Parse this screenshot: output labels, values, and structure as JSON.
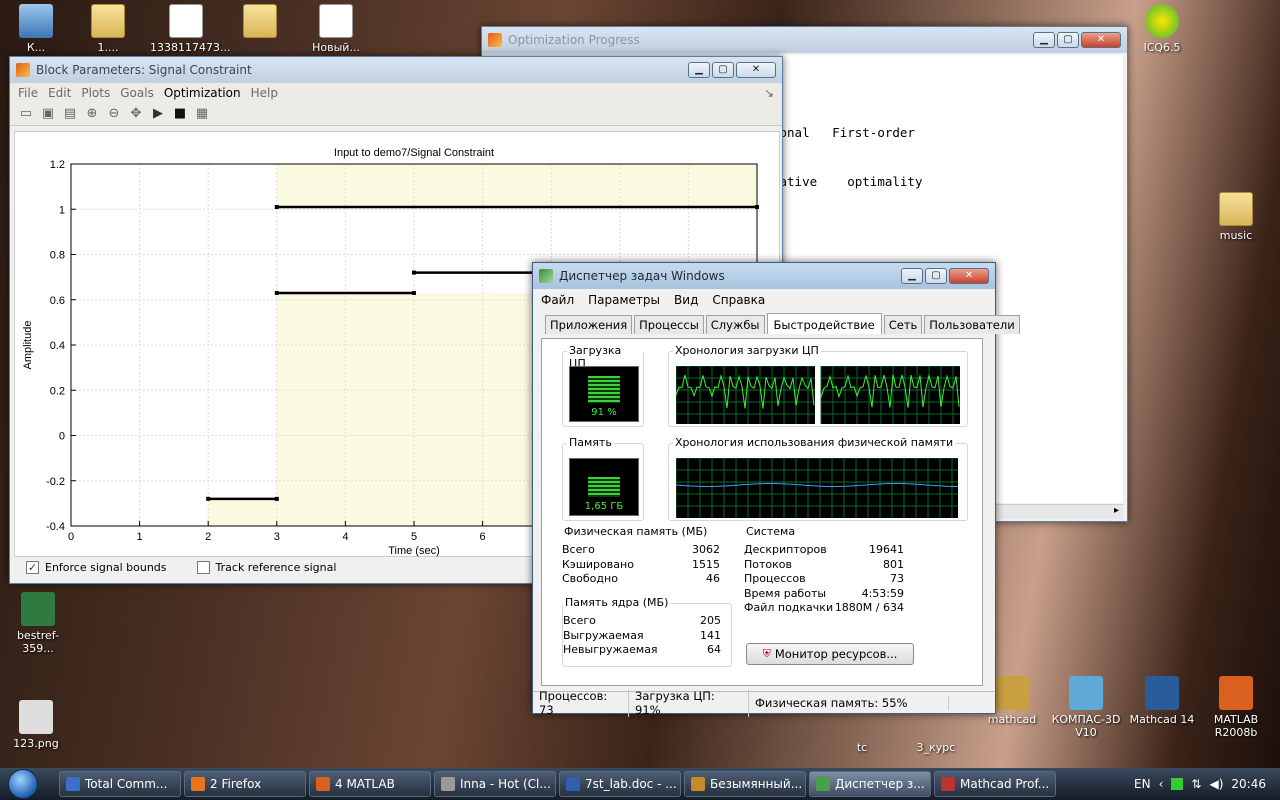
{
  "desktop": {
    "icons_left": [
      {
        "label": "К...",
        "kind": "computer"
      },
      {
        "label": "1....",
        "kind": "folder"
      },
      {
        "label": "1338117473...",
        "kind": "doc"
      },
      {
        "label": "",
        "kind": "folder"
      },
      {
        "label": "Новый...",
        "kind": "doc"
      }
    ],
    "icons_right": [
      {
        "label": "ICQ6.5"
      },
      {
        "label": "music"
      }
    ],
    "icons_bottom": [
      {
        "label": "bestref-359..."
      },
      {
        "label": "123.png"
      },
      {
        "label": "tc"
      },
      {
        "label": "3_курс"
      },
      {
        "label": "mathcad"
      },
      {
        "label": "КОМПАС-3D V10"
      },
      {
        "label": "Mathcad 14"
      },
      {
        "label": "MATLAB R2008b"
      }
    ]
  },
  "optim_window": {
    "title": "Optimization Progress",
    "lines": [
      "                 k              Directional   First-order",
      "            aint     Step-size    derivative    optimality"
    ]
  },
  "block_window": {
    "title": "Block Parameters: Signal Constraint",
    "menu": [
      "File",
      "Edit",
      "Plots",
      "Goals",
      "Optimization",
      "Help"
    ],
    "active_menu": "Optimization",
    "enforce_label": "Enforce signal bounds",
    "enforce_checked": true,
    "track_label": "Track reference signal",
    "track_checked": false
  },
  "chart_data": {
    "type": "line",
    "title": "Input to demo7/Signal Constraint",
    "xlabel": "Time (sec)",
    "ylabel": "Amplitude",
    "xlim": [
      0,
      10
    ],
    "ylim": [
      -0.4,
      1.2
    ],
    "x_ticks": [
      "0",
      "1",
      "2",
      "3",
      "4",
      "5",
      "6"
    ],
    "y_ticks": [
      "1.2",
      "1",
      "0.8",
      "0.6",
      "0.4",
      "0.2",
      "0",
      "-0.2",
      "-0.4"
    ],
    "y_tick_values": [
      1.2,
      1,
      0.8,
      0.6,
      0.4,
      0.2,
      0,
      -0.2,
      -0.4
    ],
    "shaded_regions": [
      {
        "x": [
          3,
          10
        ],
        "y": [
          1.01,
          1.2
        ],
        "color": "#fafae0"
      },
      {
        "x": [
          3,
          10
        ],
        "y": [
          -0.4,
          0.63
        ],
        "color": "#fafae0"
      },
      {
        "x": [
          2,
          3
        ],
        "y": [
          -0.4,
          -0.28
        ],
        "color": "#fafae0"
      }
    ],
    "series": [
      {
        "segments": [
          {
            "x": [
              3,
              10
            ],
            "y": [
              1.01,
              1.01
            ]
          },
          {
            "x": [
              3,
              5
            ],
            "y": [
              0.63,
              0.63
            ]
          },
          {
            "x": [
              5,
              10
            ],
            "y": [
              0.72,
              0.72
            ]
          },
          {
            "x": [
              2,
              3
            ],
            "y": [
              -0.28,
              -0.28
            ]
          }
        ]
      }
    ],
    "grid": true
  },
  "taskmgr": {
    "title": "Диспетчер задач Windows",
    "menu": [
      "Файл",
      "Параметры",
      "Вид",
      "Справка"
    ],
    "tabs": [
      "Приложения",
      "Процессы",
      "Службы",
      "Быстродействие",
      "Сеть",
      "Пользователи"
    ],
    "selected_tab": "Быстродействие",
    "cpu_label": "Загрузка ЦП",
    "cpu_value": "91 %",
    "cpu_level": 0.91,
    "cpu_history_label": "Хронология загрузки ЦП",
    "mem_label": "Память",
    "mem_value": "1,65 ГБ",
    "mem_level": 0.55,
    "mem_history_label": "Хронология использования физической памяти",
    "phys_title": "Физическая память (МБ)",
    "phys": [
      {
        "k": "Всего",
        "v": "3062"
      },
      {
        "k": "Кэшировано",
        "v": "1515"
      },
      {
        "k": "Свободно",
        "v": "46"
      }
    ],
    "kernel_title": "Память ядра (МБ)",
    "kernel": [
      {
        "k": "Всего",
        "v": "205"
      },
      {
        "k": "Выгружаемая",
        "v": "141"
      },
      {
        "k": "Невыгружаемая",
        "v": "64"
      }
    ],
    "system_title": "Система",
    "system": [
      {
        "k": "Дескрипторов",
        "v": "19641"
      },
      {
        "k": "Потоков",
        "v": "801"
      },
      {
        "k": "Процессов",
        "v": "73"
      },
      {
        "k": "Время работы",
        "v": "4:53:59"
      },
      {
        "k": "Файл подкачки",
        "v": "1880M / 634"
      }
    ],
    "resmon_button": "Монитор ресурсов...",
    "status": [
      "Процессов: 73",
      "Загрузка ЦП: 91%",
      "Физическая память: 55%"
    ]
  },
  "taskbar": {
    "buttons": [
      {
        "label": "Total Comm...",
        "color": "#3b6fc9"
      },
      {
        "label": "2 Firefox",
        "color": "#e8741b"
      },
      {
        "label": "4 MATLAB",
        "color": "#d9601e"
      },
      {
        "label": "Inna - Hot (Cl...",
        "color": "#9a9a9a"
      },
      {
        "label": "7st_lab.doc - ...",
        "color": "#2f5fae"
      },
      {
        "label": "Безымянный...",
        "color": "#c78a2a"
      },
      {
        "label": "Диспетчер з...",
        "color": "#4aa04a"
      },
      {
        "label": "Mathcad Prof...",
        "color": "#b33"
      }
    ],
    "active_index": 6,
    "lang": "EN",
    "clock": "20:46"
  }
}
